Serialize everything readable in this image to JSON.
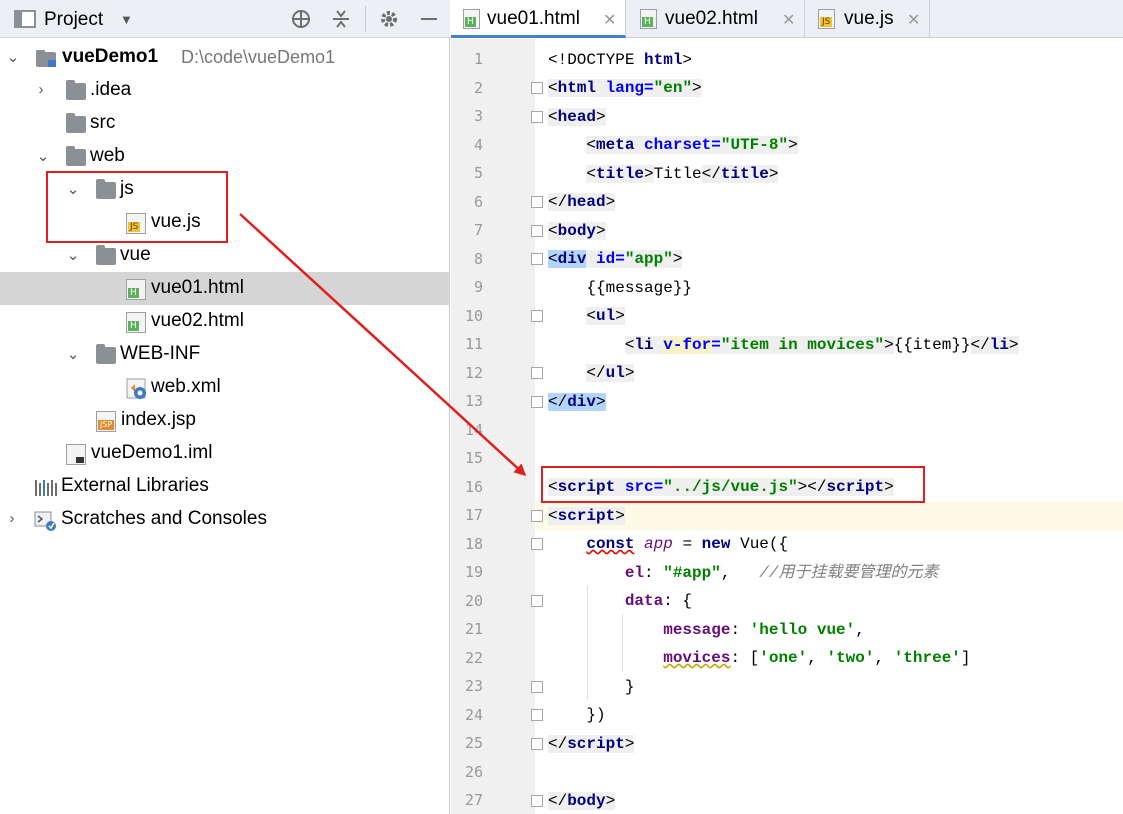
{
  "project_panel": {
    "title": "Project",
    "tree": [
      {
        "id": "root",
        "label": "vueDemo1",
        "path": "D:\\code\\vueDemo1",
        "type": "module"
      },
      {
        "id": "idea",
        "label": ".idea",
        "type": "folder"
      },
      {
        "id": "src",
        "label": "src",
        "type": "folder"
      },
      {
        "id": "web",
        "label": "web",
        "type": "folder"
      },
      {
        "id": "js",
        "label": "js",
        "type": "folder"
      },
      {
        "id": "vuejs",
        "label": "vue.js",
        "type": "js",
        "tag": "JS"
      },
      {
        "id": "vue",
        "label": "vue",
        "type": "folder"
      },
      {
        "id": "vue01",
        "label": "vue01.html",
        "type": "html",
        "tag": "H"
      },
      {
        "id": "vue02",
        "label": "vue02.html",
        "type": "html",
        "tag": "H"
      },
      {
        "id": "webinf",
        "label": "WEB-INF",
        "type": "folder"
      },
      {
        "id": "webxml",
        "label": "web.xml",
        "type": "xml"
      },
      {
        "id": "indexjsp",
        "label": "index.jsp",
        "type": "jsp",
        "tag": "JSP"
      },
      {
        "id": "iml",
        "label": "vueDemo1.iml",
        "type": "iml"
      },
      {
        "id": "extlib",
        "label": "External Libraries",
        "type": "library"
      },
      {
        "id": "scratch",
        "label": "Scratches and Consoles",
        "type": "scratch"
      }
    ]
  },
  "tabs": [
    {
      "label": "vue01.html",
      "tag": "H",
      "active": true
    },
    {
      "label": "vue02.html",
      "tag": "H",
      "active": false
    },
    {
      "label": "vue.js",
      "tag": "JS",
      "active": false
    }
  ],
  "editor": {
    "line_numbers": [
      "1",
      "2",
      "3",
      "4",
      "5",
      "6",
      "7",
      "8",
      "9",
      "10",
      "11",
      "12",
      "13",
      "14",
      "15",
      "16",
      "17",
      "18",
      "19",
      "20",
      "21",
      "22",
      "23",
      "24",
      "25",
      "26",
      "27"
    ],
    "lines": {
      "l1": {
        "a": "<!DOCTYPE ",
        "b": "html",
        "c": ">"
      },
      "l2": {
        "a": "<",
        "b": "html",
        "c": "lang",
        "d": "=",
        "e": "\"en\"",
        "f": ">"
      },
      "l3": {
        "a": "<",
        "b": "head",
        "c": ">"
      },
      "l4": {
        "a": "<",
        "b": "meta",
        "c": "charset",
        "d": "=",
        "e": "\"UTF-8\"",
        "f": ">"
      },
      "l5": {
        "a": "<",
        "b": "title",
        "c": ">",
        "d": "Title",
        "e": "</",
        "f": "title",
        "g": ">"
      },
      "l6": {
        "a": "</",
        "b": "head",
        "c": ">"
      },
      "l7": {
        "a": "<",
        "b": "body",
        "c": ">"
      },
      "l8": {
        "a": "<",
        "b": "div",
        "c": "id",
        "d": "=",
        "e": "\"app\"",
        "f": ">"
      },
      "l9": {
        "a": "{{message}}"
      },
      "l10": {
        "a": "<",
        "b": "ul",
        "c": ">"
      },
      "l11": {
        "a": "<",
        "b": "li",
        "c": "v-for",
        "d": "=",
        "e": "\"item in movices\"",
        "f": ">",
        "g": "{{item}}",
        "h": "</",
        "i": "li",
        "j": ">"
      },
      "l12": {
        "a": "</",
        "b": "ul",
        "c": ">"
      },
      "l13": {
        "a": "</",
        "b": "div",
        "c": ">"
      },
      "l16": {
        "a": "<",
        "b": "script",
        "c": "src",
        "d": "=",
        "e": "\"../js/vue.js\"",
        "f": ">",
        "g": "</",
        "h": "script",
        "i": ">"
      },
      "l17": {
        "a": "<",
        "b": "script",
        "c": ">"
      },
      "l18": {
        "a": "const",
        "b": "app",
        "c": "=",
        "d": "new",
        "e": "Vue({"
      },
      "l19": {
        "a": "el",
        "b": ": ",
        "c": "\"#app\"",
        "d": ",",
        "e": "//用于挂载要管理的元素"
      },
      "l20": {
        "a": "data",
        "b": ": {"
      },
      "l21": {
        "a": "message",
        "b": ": ",
        "c": "'hello vue'",
        "d": ","
      },
      "l22": {
        "a": "movices",
        "b": ": [",
        "c": "'one'",
        "d": ", ",
        "e": "'two'",
        "f": ", ",
        "g": "'three'",
        "h": "]"
      },
      "l23": {
        "a": "}"
      },
      "l24": {
        "a": "})"
      },
      "l25": {
        "a": "</",
        "b": "script",
        "c": ">"
      },
      "l27": {
        "a": "</",
        "b": "body",
        "c": ">"
      }
    }
  },
  "annotation_color": "#e02020"
}
